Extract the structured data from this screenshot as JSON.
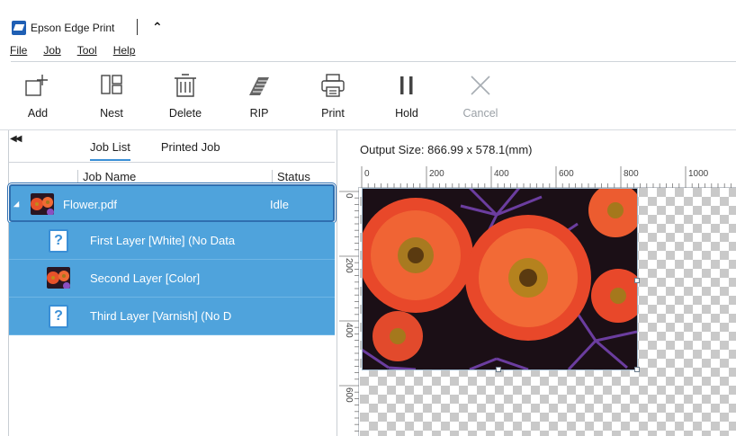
{
  "app": {
    "title": "Epson Edge Print"
  },
  "menu": [
    {
      "label": "File"
    },
    {
      "label": "Job"
    },
    {
      "label": "Tool"
    },
    {
      "label": "Help"
    }
  ],
  "toolbar": {
    "add": "Add",
    "nest": "Nest",
    "delete": "Delete",
    "rip": "RIP",
    "print": "Print",
    "hold": "Hold",
    "cancel": "Cancel"
  },
  "tabs": {
    "job_list": "Job List",
    "printed_job": "Printed Job"
  },
  "columns": {
    "job_name": "Job Name",
    "status": "Status"
  },
  "jobs": {
    "parent": {
      "name": "Flower.pdf",
      "status": "Idle"
    },
    "layers": [
      {
        "name": "First Layer [White]  (No Data",
        "has_data": false
      },
      {
        "name": "Second Layer [Color]",
        "has_data": true
      },
      {
        "name": "Third Layer [Varnish]  (No D",
        "has_data": false
      }
    ]
  },
  "output": {
    "label": "Output Size:",
    "value": "866.99 x 578.1(mm)"
  },
  "ruler": {
    "h_ticks": [
      "0",
      "200",
      "400",
      "600",
      "800",
      "1000"
    ],
    "v_ticks": [
      "0",
      "200",
      "400",
      "600"
    ]
  },
  "colors": {
    "selection": "#4fa3dc",
    "accent": "#3a8fd6"
  }
}
